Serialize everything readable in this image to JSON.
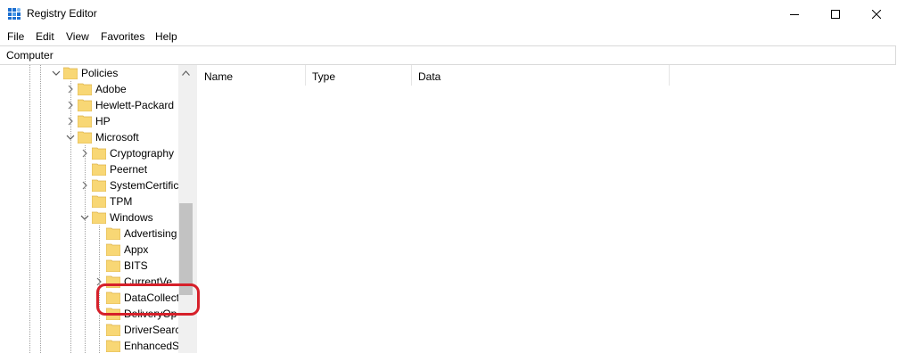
{
  "window": {
    "title": "Registry Editor"
  },
  "menu": [
    "File",
    "Edit",
    "View",
    "Favorites",
    "Help"
  ],
  "address": "Computer",
  "tree": {
    "policies": "Policies",
    "adobe": "Adobe",
    "hewlett_packard": "Hewlett-Packard",
    "hp": "HP",
    "microsoft": "Microsoft",
    "cryptography": "Cryptography",
    "peernet": "Peernet",
    "systemcertific": "SystemCertific",
    "tpm": "TPM",
    "windows": "Windows",
    "advertising": "Advertising",
    "appx": "Appx",
    "bits": "BITS",
    "currentversion": "CurrentVe",
    "datacollection": "DataCollect",
    "deliveryop": "DeliveryOp",
    "driversearch": "DriverSearc",
    "enhanced": "EnhancedS"
  },
  "columns": {
    "name": "Name",
    "type": "Type",
    "data": "Data"
  },
  "colors": {
    "highlight": "#d6202a",
    "folder": "#f8d775"
  }
}
